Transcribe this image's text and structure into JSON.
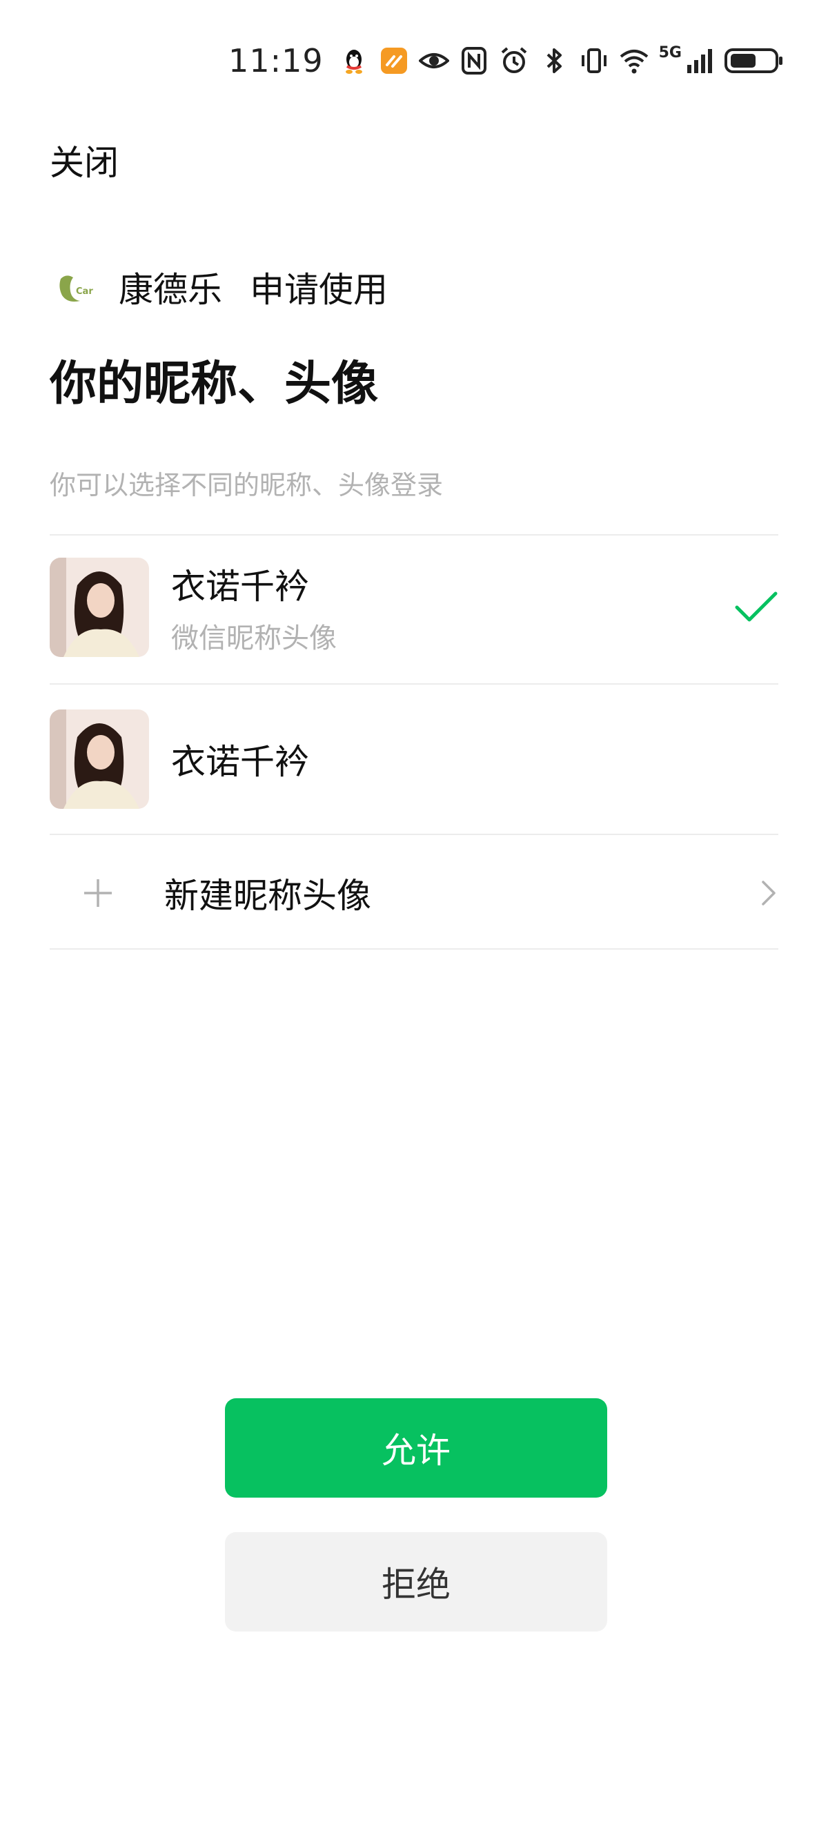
{
  "status_bar": {
    "time": "11:19",
    "network": "5G",
    "icons": [
      "qq-icon",
      "app-notification-icon",
      "eye-icon",
      "nfc-icon",
      "alarm-icon",
      "bluetooth-icon",
      "vibrate-icon",
      "wifi-icon",
      "signal-icon",
      "battery-icon"
    ]
  },
  "header": {
    "close_label": "关闭"
  },
  "request": {
    "app_name": "康德乐",
    "action_label": "申请使用",
    "title": "你的昵称、头像",
    "hint": "你可以选择不同的昵称、头像登录"
  },
  "profiles": [
    {
      "name": "衣诺千衿",
      "subtitle": "微信昵称头像",
      "selected": true
    },
    {
      "name": "衣诺千衿",
      "subtitle": "",
      "selected": false
    }
  ],
  "new_profile": {
    "label": "新建昵称头像"
  },
  "buttons": {
    "allow": "允许",
    "reject": "拒绝"
  },
  "colors": {
    "accent": "#07c160",
    "secondary_button": "#f2f2f2",
    "hint_text": "#b2b2b2"
  }
}
